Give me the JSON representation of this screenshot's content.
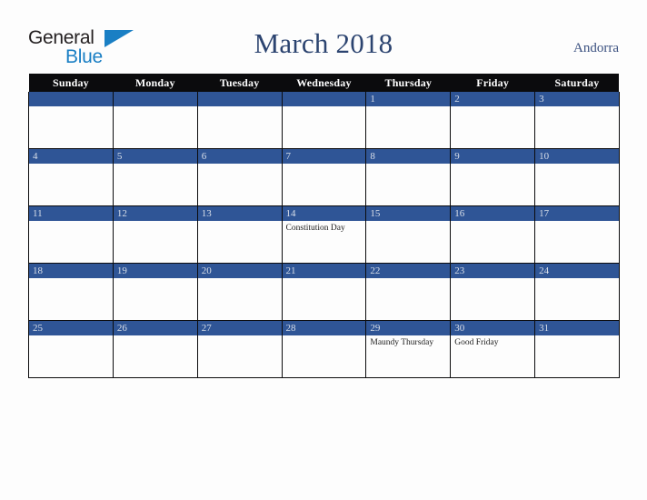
{
  "logo": {
    "text_primary": "General",
    "text_secondary": "Blue",
    "triangle_icon": "blue-triangle-icon",
    "primary_color": "#231f20",
    "secondary_color": "#1a7fc4"
  },
  "header": {
    "title": "March 2018",
    "country": "Andorra",
    "title_color": "#2c4470",
    "country_color": "#3b5180"
  },
  "colors": {
    "weekday_header_bg": "#0b0b0d",
    "weekday_header_text": "#ffffff",
    "daynum_bar_bg": "#2f5596",
    "daynum_text": "#d9dfe9",
    "cell_bg": "#fdfdfd",
    "page_bg": "#fdfdfd",
    "grid_line": "#0b0b0d"
  },
  "weekdays": [
    "Sunday",
    "Monday",
    "Tuesday",
    "Wednesday",
    "Thursday",
    "Friday",
    "Saturday"
  ],
  "weeks": [
    [
      {
        "day": "",
        "events": []
      },
      {
        "day": "",
        "events": []
      },
      {
        "day": "",
        "events": []
      },
      {
        "day": "",
        "events": []
      },
      {
        "day": "1",
        "events": []
      },
      {
        "day": "2",
        "events": []
      },
      {
        "day": "3",
        "events": []
      }
    ],
    [
      {
        "day": "4",
        "events": []
      },
      {
        "day": "5",
        "events": []
      },
      {
        "day": "6",
        "events": []
      },
      {
        "day": "7",
        "events": []
      },
      {
        "day": "8",
        "events": []
      },
      {
        "day": "9",
        "events": []
      },
      {
        "day": "10",
        "events": []
      }
    ],
    [
      {
        "day": "11",
        "events": []
      },
      {
        "day": "12",
        "events": []
      },
      {
        "day": "13",
        "events": []
      },
      {
        "day": "14",
        "events": [
          "Constitution Day"
        ]
      },
      {
        "day": "15",
        "events": []
      },
      {
        "day": "16",
        "events": []
      },
      {
        "day": "17",
        "events": []
      }
    ],
    [
      {
        "day": "18",
        "events": []
      },
      {
        "day": "19",
        "events": []
      },
      {
        "day": "20",
        "events": []
      },
      {
        "day": "21",
        "events": []
      },
      {
        "day": "22",
        "events": []
      },
      {
        "day": "23",
        "events": []
      },
      {
        "day": "24",
        "events": []
      }
    ],
    [
      {
        "day": "25",
        "events": []
      },
      {
        "day": "26",
        "events": []
      },
      {
        "day": "27",
        "events": []
      },
      {
        "day": "28",
        "events": []
      },
      {
        "day": "29",
        "events": [
          "Maundy Thursday"
        ]
      },
      {
        "day": "30",
        "events": [
          "Good Friday"
        ]
      },
      {
        "day": "31",
        "events": []
      }
    ]
  ]
}
